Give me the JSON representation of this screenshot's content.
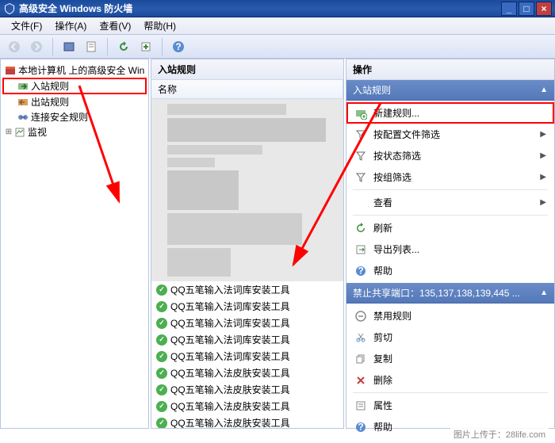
{
  "title": "高级安全 Windows 防火墙",
  "menus": {
    "file": "文件(F)",
    "action": "操作(A)",
    "view": "查看(V)",
    "help": "帮助(H)"
  },
  "tree": {
    "root": "本地计算机 上的高级安全 Win",
    "inbound": "入站规则",
    "outbound": "出站规则",
    "connsec": "连接安全规则",
    "monitor": "监视"
  },
  "center": {
    "header": "入站规则",
    "col_name": "名称"
  },
  "rules": [
    "QQ五笔输入法词库安装工具",
    "QQ五笔输入法词库安装工具",
    "QQ五笔输入法词库安装工具",
    "QQ五笔输入法词库安装工具",
    "QQ五笔输入法词库安装工具",
    "QQ五笔输入法皮肤安装工具",
    "QQ五笔输入法皮肤安装工具",
    "QQ五笔输入法皮肤安装工具",
    "QQ五笔输入法皮肤安装工具",
    "QQ五笔输入法皮肤安装工具"
  ],
  "actions": {
    "header": "操作",
    "section1": "入站规则",
    "newrule": "新建规则...",
    "filter_profile": "按配置文件筛选",
    "filter_state": "按状态筛选",
    "filter_group": "按组筛选",
    "view": "查看",
    "refresh": "刷新",
    "export": "导出列表...",
    "help": "帮助",
    "section2": "禁止共享端口：135,137,138,139,445 ...",
    "disable_rule": "禁用规则",
    "cut": "剪切",
    "copy": "复制",
    "delete": "删除",
    "properties": "属性",
    "help2": "帮助"
  },
  "watermark": "图片上传于：28life.com"
}
